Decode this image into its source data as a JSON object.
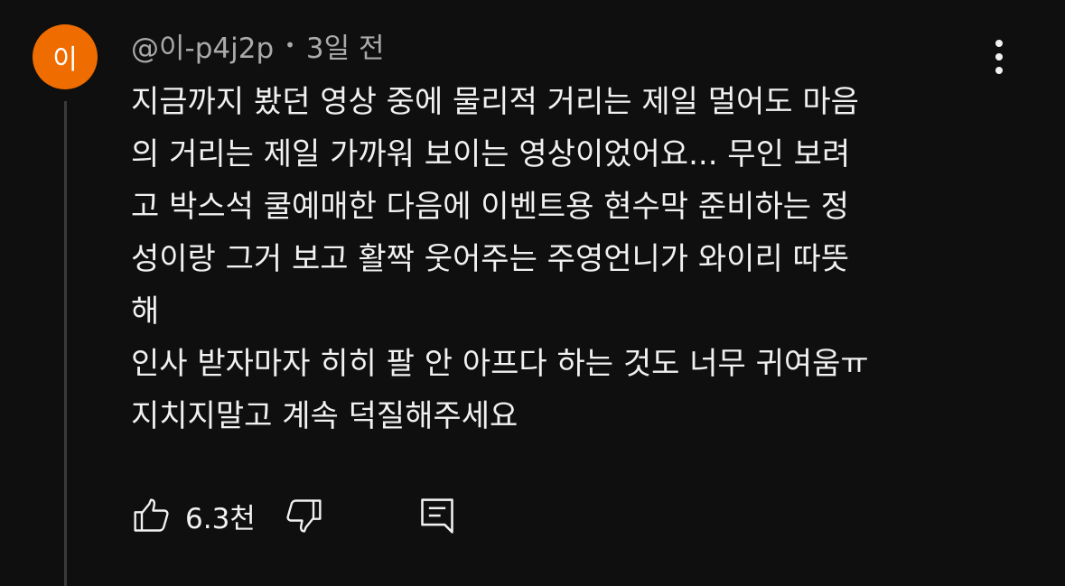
{
  "comment": {
    "avatar_text": "이",
    "avatar_color": "#ef6c00",
    "author": "@이-p4j2p",
    "separator": "•",
    "time": "3일 전",
    "lines": [
      "지금까지 봤던 영상 중에 물리적 거리는 제일 멀어도 마음",
      "의 거리는 제일 가까워 보이는 영상이었어요... 무인 보려",
      "고 박스석 쿨예매한 다음에 이벤트용 현수막 준비하는 정",
      "성이랑 그거 보고 활짝 웃어주는 주영언니가 와이리 따뜻",
      "해",
      "인사 받자마자 히히 팔 안 아프다 하는 것도 너무 귀여움ㅠ",
      "지치지말고 계속 덕질해주세요"
    ]
  },
  "actions": {
    "like_icon": "thumbs-up-icon",
    "like_count": "6.3천",
    "dislike_icon": "thumbs-down-icon",
    "reply_icon": "comment-icon"
  },
  "menu_icon": "more-vertical-icon",
  "colors": {
    "background": "#0f0f0f",
    "text_primary": "#f1f1f1",
    "text_secondary": "#aaaaaa",
    "thread_line": "#3a3a3a"
  }
}
